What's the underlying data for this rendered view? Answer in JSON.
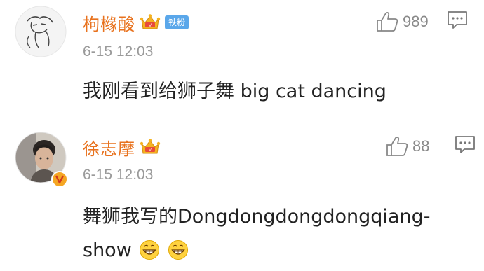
{
  "comments": [
    {
      "username": "枸橼酸",
      "badge": "铁粉",
      "timestamp": "6-15 12:03",
      "like_count": "989",
      "text_line1": "我刚看到给狮子舞 big cat dancing",
      "text_line2": "",
      "icons": [
        "avatar-sketch",
        "vip-crown-icon",
        "like-icon",
        "reply-icon"
      ]
    },
    {
      "username": "徐志摩",
      "badge": "",
      "timestamp": "6-15 12:03",
      "like_count": "88",
      "text_line1": "舞狮我写的Dongdongdongdongqiang-",
      "text_line2": "show",
      "icons": [
        "avatar-photo",
        "verified-v-icon",
        "vip-crown-icon",
        "like-icon",
        "reply-icon",
        "grin-emoji-icon",
        "grin-emoji-icon"
      ]
    }
  ],
  "colors": {
    "username": "#e8721e",
    "badge": "#5aa7ea",
    "verified": "#f5a623",
    "timestamp": "#9a9a9a",
    "text": "#222222"
  }
}
